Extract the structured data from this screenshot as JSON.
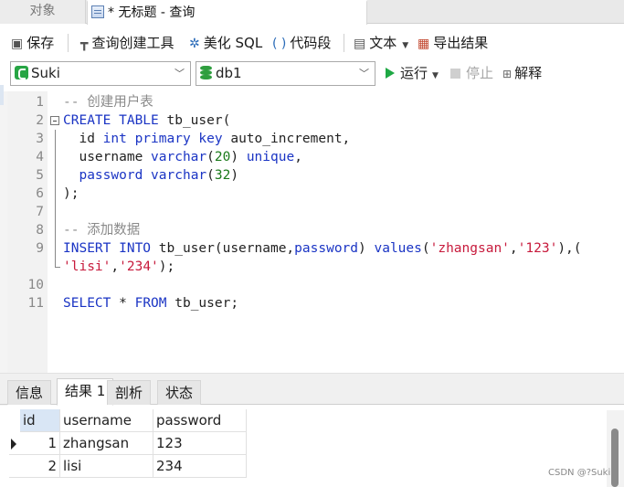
{
  "tabs": {
    "objects": "对象",
    "query": "* 无标题 - 查询"
  },
  "toolbar": {
    "save": "保存",
    "query_builder": "查询创建工具",
    "beautify": "美化 SQL",
    "snippets": "代码段",
    "text": "文本",
    "export": "导出结果"
  },
  "connection": {
    "name": "Suki",
    "database": "db1",
    "run": "运行",
    "stop": "停止",
    "explain": "解释"
  },
  "editor": {
    "line_numbers": [
      "1",
      "2",
      "3",
      "4",
      "5",
      "6",
      "7",
      "8",
      "9",
      "",
      "10",
      "11"
    ],
    "lines": [
      [
        {
          "t": "-- 创建用户表",
          "c": "cm"
        }
      ],
      [
        {
          "t": "CREATE TABLE",
          "c": "kw"
        },
        {
          "t": " tb_user(",
          "c": "pl"
        }
      ],
      [
        {
          "t": "  id ",
          "c": "pl"
        },
        {
          "t": "int primary key",
          "c": "kw"
        },
        {
          "t": " auto_increment,",
          "c": "pl"
        }
      ],
      [
        {
          "t": "  username ",
          "c": "pl"
        },
        {
          "t": "varchar",
          "c": "kw"
        },
        {
          "t": "(",
          "c": "pl"
        },
        {
          "t": "20",
          "c": "num"
        },
        {
          "t": ") ",
          "c": "pl"
        },
        {
          "t": "unique",
          "c": "kw"
        },
        {
          "t": ",",
          "c": "pl"
        }
      ],
      [
        {
          "t": "  ",
          "c": "pl"
        },
        {
          "t": "password",
          "c": "kw"
        },
        {
          "t": " ",
          "c": "pl"
        },
        {
          "t": "varchar",
          "c": "kw"
        },
        {
          "t": "(",
          "c": "pl"
        },
        {
          "t": "32",
          "c": "num"
        },
        {
          "t": ")",
          "c": "pl"
        }
      ],
      [
        {
          "t": ");",
          "c": "pl"
        }
      ],
      [],
      [
        {
          "t": "-- 添加数据",
          "c": "cm"
        }
      ],
      [
        {
          "t": "INSERT INTO",
          "c": "kw"
        },
        {
          "t": " tb_user(username,",
          "c": "pl"
        },
        {
          "t": "password",
          "c": "kw"
        },
        {
          "t": ") ",
          "c": "pl"
        },
        {
          "t": "values",
          "c": "kw"
        },
        {
          "t": "(",
          "c": "pl"
        },
        {
          "t": "'zhangsan'",
          "c": "str"
        },
        {
          "t": ",",
          "c": "pl"
        },
        {
          "t": "'123'",
          "c": "str"
        },
        {
          "t": "),(",
          "c": "pl"
        }
      ],
      [
        {
          "t": "'lisi'",
          "c": "str"
        },
        {
          "t": ",",
          "c": "pl"
        },
        {
          "t": "'234'",
          "c": "str"
        },
        {
          "t": ");",
          "c": "pl"
        }
      ],
      [],
      [
        {
          "t": "SELECT",
          "c": "kw"
        },
        {
          "t": " * ",
          "c": "pl"
        },
        {
          "t": "FROM",
          "c": "kw"
        },
        {
          "t": " tb_user;",
          "c": "pl"
        }
      ]
    ]
  },
  "result_tabs": [
    "信息",
    "结果 1",
    "剖析",
    "状态"
  ],
  "result_active_tab": "结果 1",
  "result_grid": {
    "columns": [
      "id",
      "username",
      "password"
    ],
    "rows": [
      [
        "1",
        "zhangsan",
        "123"
      ],
      [
        "2",
        "lisi",
        "234"
      ]
    ]
  },
  "watermark": "CSDN @?Suki",
  "colors": {
    "keyword": "#1a34c4",
    "comment": "#8a8a8a",
    "string": "#c71a3c",
    "number": "#1a7a1a",
    "run": "#1ea844"
  },
  "icons": {
    "save": "floppy-icon",
    "query_builder": "hammer-icon",
    "beautify": "magic-wand-icon",
    "snippets": "braces-icon",
    "text": "document-icon",
    "export": "export-table-icon"
  }
}
